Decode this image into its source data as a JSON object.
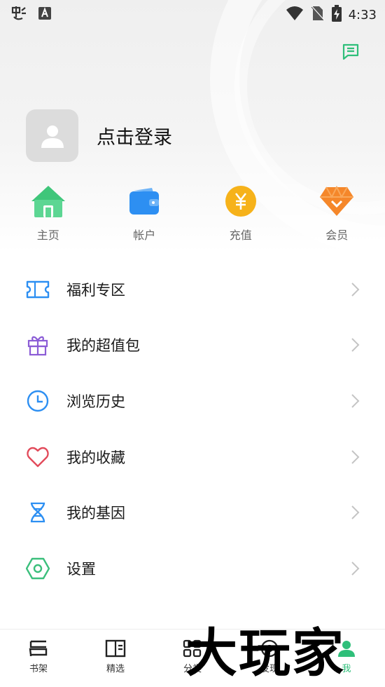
{
  "status_bar": {
    "time": "4:33",
    "icons": [
      "app-bug-icon",
      "font-a-icon",
      "wifi-icon",
      "no-sim-icon",
      "battery-charging-icon"
    ]
  },
  "header": {
    "message_icon": "message-icon"
  },
  "profile": {
    "login_text": "点击登录",
    "avatar_icon": "user-placeholder-icon"
  },
  "quick_actions": [
    {
      "label": "主页",
      "icon": "home-icon",
      "color": "#4fcf83"
    },
    {
      "label": "帐户",
      "icon": "wallet-icon",
      "color": "#2d8ff2"
    },
    {
      "label": "充值",
      "icon": "yen-coin-icon",
      "color": "#f6b21a"
    },
    {
      "label": "会员",
      "icon": "vip-diamond-icon",
      "color": "#f5872a"
    }
  ],
  "menu": [
    {
      "label": "福利专区",
      "icon": "ticket-icon",
      "color": "#2d8ff2"
    },
    {
      "label": "我的超值包",
      "icon": "gift-icon",
      "color": "#8b5cd6"
    },
    {
      "label": "浏览历史",
      "icon": "clock-icon",
      "color": "#2d8ff2"
    },
    {
      "label": "我的收藏",
      "icon": "heart-icon",
      "color": "#e24b5b"
    },
    {
      "label": "我的基因",
      "icon": "dna-icon",
      "color": "#2d8ff2"
    },
    {
      "label": "设置",
      "icon": "hexagon-settings-icon",
      "color": "#3bbf7c"
    }
  ],
  "tabbar": [
    {
      "label": "书架",
      "icon": "bookshelf-icon",
      "active": false
    },
    {
      "label": "精选",
      "icon": "book-open-icon",
      "active": false
    },
    {
      "label": "分类",
      "icon": "grid-icon",
      "active": false
    },
    {
      "label": "发现",
      "icon": "discover-icon",
      "active": false
    },
    {
      "label": "我",
      "icon": "profile-icon",
      "active": true
    }
  ],
  "watermark": "大玩家",
  "colors": {
    "accent": "#2fbf7a",
    "text": "#1a1a1a",
    "muted": "#666666"
  }
}
